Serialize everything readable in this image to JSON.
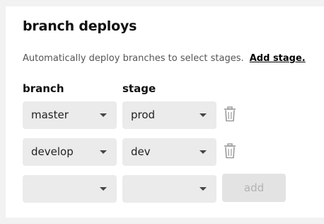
{
  "section": {
    "title": "branch deploys",
    "description": "Automatically deploy branches to select stages.",
    "add_stage_link": "Add stage."
  },
  "columns": {
    "branch": "branch",
    "stage": "stage"
  },
  "rows": [
    {
      "branch": "master",
      "stage": "prod"
    },
    {
      "branch": "develop",
      "stage": "dev"
    }
  ],
  "new_row": {
    "branch": "",
    "stage": "",
    "add_label": "add"
  },
  "icons": {
    "dropdown": "chevron-down-icon",
    "delete": "trash-icon"
  },
  "colors": {
    "select_bg": "#ebebeb",
    "button_disabled_bg": "#e3e3e3",
    "button_disabled_text": "#b3b3b3"
  }
}
